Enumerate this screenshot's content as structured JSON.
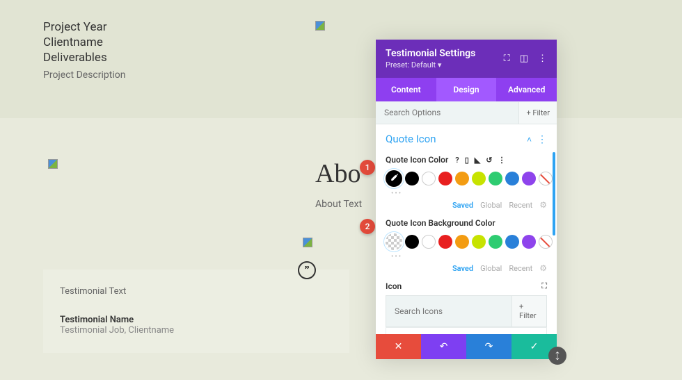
{
  "header": {
    "line1": "Project Year",
    "line2": "Clientname",
    "line3": "Deliverables",
    "desc": "Project Description"
  },
  "about": {
    "title": "Abo",
    "text": "About Text"
  },
  "testimonial": {
    "text": "Testimonial Text",
    "name": "Testimonial Name",
    "job": "Testimonial Job, Clientname",
    "quote_symbol": "”"
  },
  "panel": {
    "title": "Testimonial Settings",
    "preset": "Preset: Default ▾",
    "tabs": {
      "content": "Content",
      "design": "Design",
      "advanced": "Advanced"
    },
    "search_placeholder": "Search Options",
    "filter_label": "+  Filter",
    "section_title": "Quote Icon",
    "opt1_label": "Quote Icon Color",
    "opt2_label": "Quote Icon Background Color",
    "sgr": {
      "saved": "Saved",
      "global": "Global",
      "recent": "Recent"
    },
    "icon_label": "Icon",
    "icon_search_placeholder": "Search Icons",
    "icon_filter_label": "+  Filter",
    "colors": {
      "black": "#000000",
      "red": "#e81f1f",
      "orange": "#f39c12",
      "yellow": "#c7e300",
      "green": "#2ecc71",
      "blue": "#2980d9",
      "purple": "#8e44ec"
    },
    "icon_grid": [
      [
        "↑",
        "↓",
        "←",
        "→",
        "↖",
        "↗",
        "↘",
        "↙",
        "↕"
      ],
      [
        "⤡",
        "↔",
        "⇔",
        "⤢",
        "↙",
        "↗",
        "↘",
        "+",
        "<"
      ],
      [
        ">",
        "",
        "",
        "",
        "",
        "",
        "",
        "»",
        "ˇ"
      ]
    ]
  },
  "badges": {
    "one": "1",
    "two": "2"
  }
}
